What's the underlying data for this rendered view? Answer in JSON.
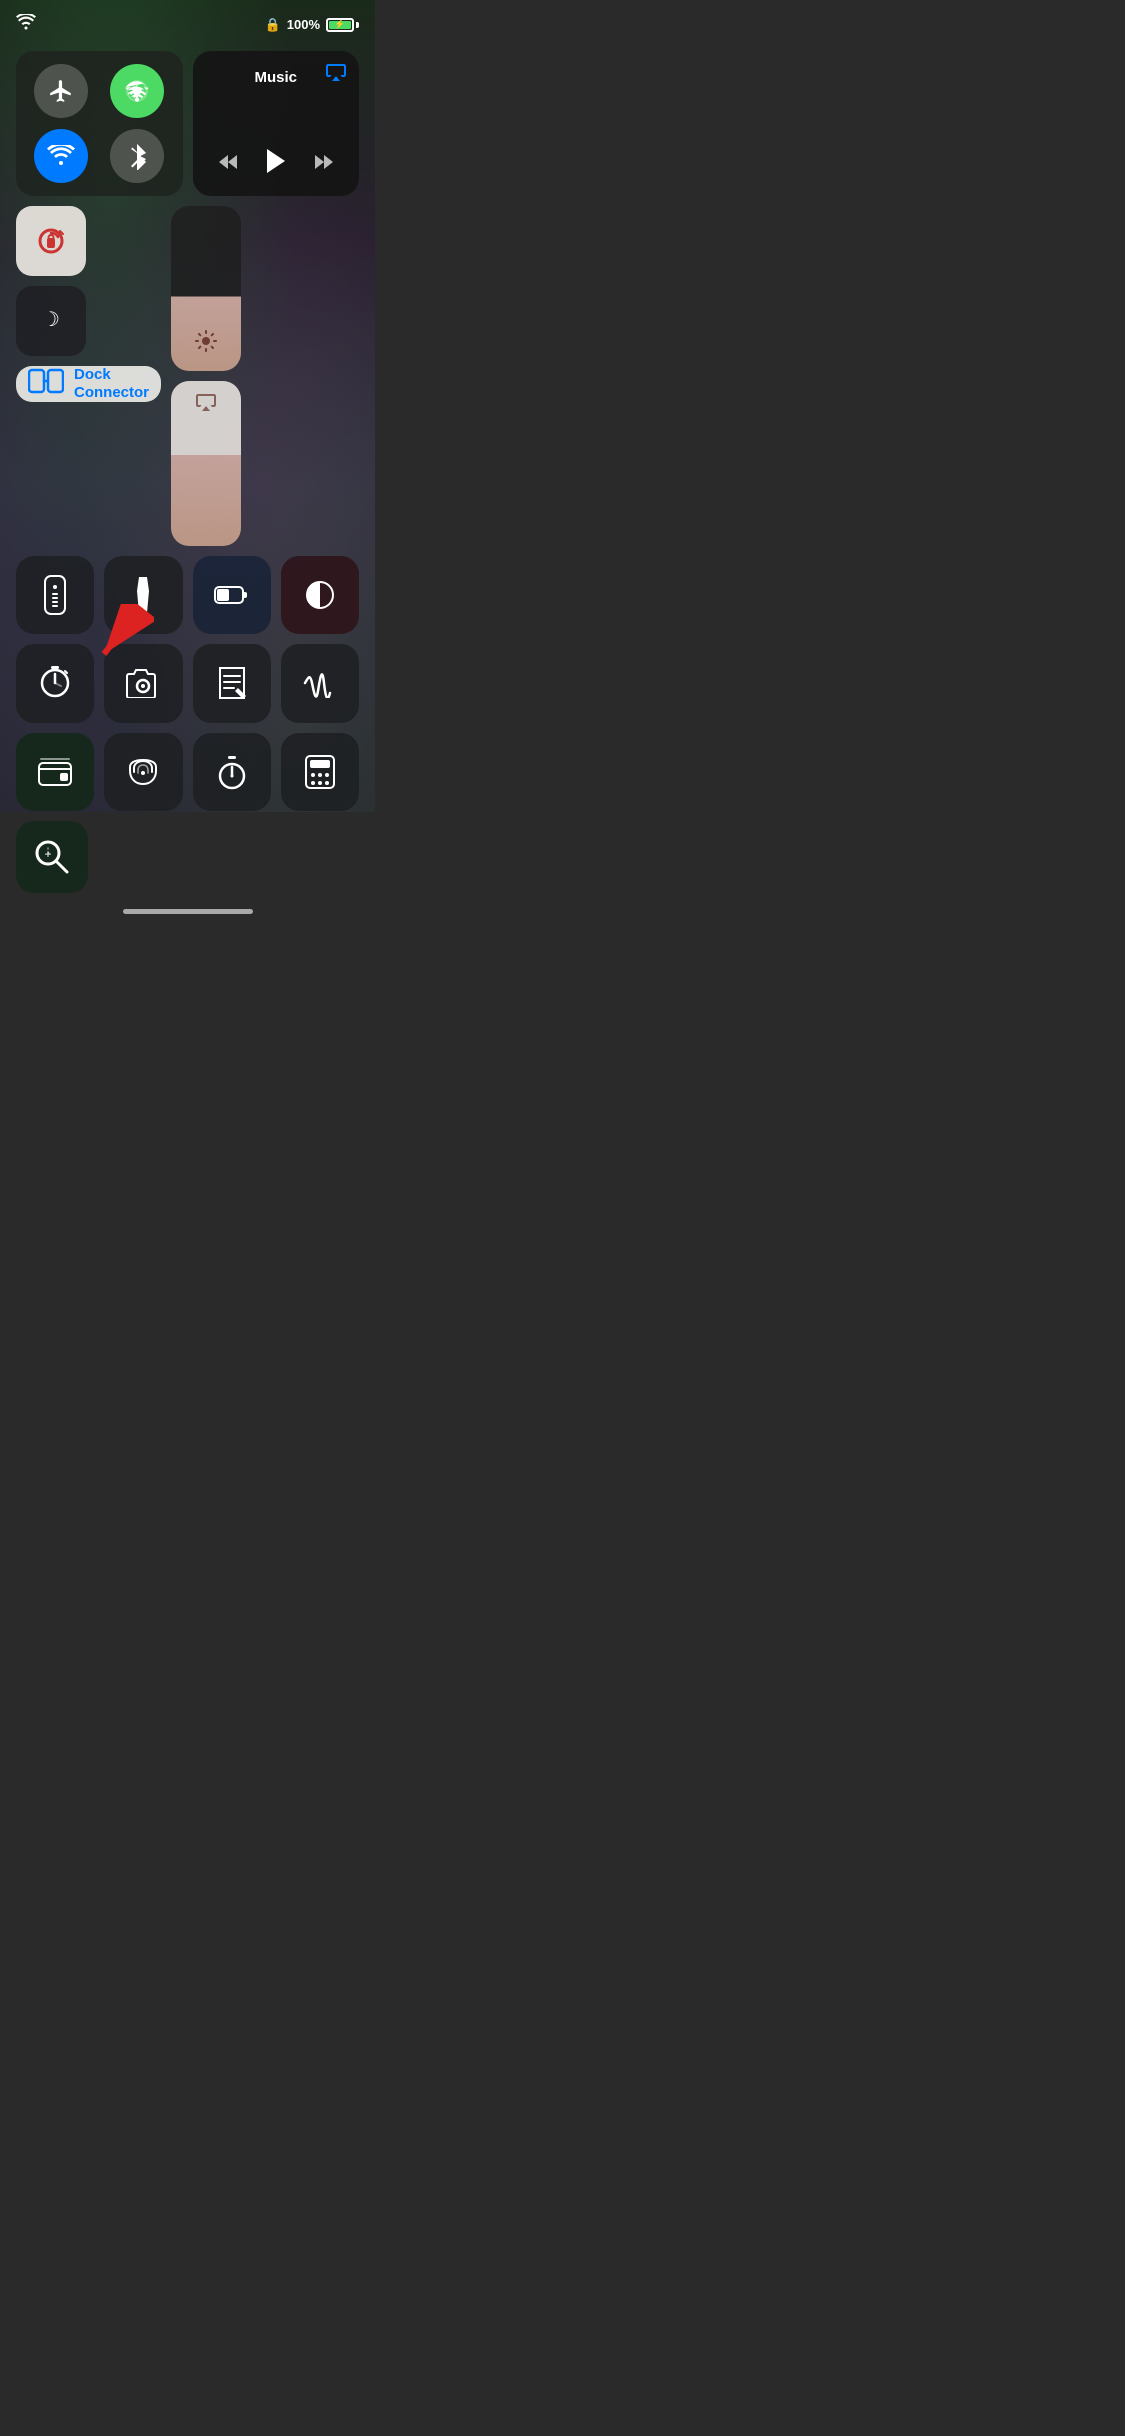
{
  "status_bar": {
    "battery_percent": "100%",
    "wifi_signal": "wifi"
  },
  "music_panel": {
    "title": "Music",
    "airplay_icon": "airplay",
    "rewind_label": "⏮",
    "play_label": "▶",
    "fastforward_label": "⏭"
  },
  "connectivity": {
    "airplane_label": "✈",
    "cellular_label": "cellular",
    "wifi_label": "wifi",
    "bluetooth_label": "bluetooth"
  },
  "controls": {
    "rotation_lock_label": "rotation-lock",
    "do_not_disturb_label": "do-not-disturb",
    "brightness_label": "brightness",
    "volume_label": "volume"
  },
  "dock_connector": {
    "label_line1": "Dock",
    "label_line2": "Connector"
  },
  "app_buttons": [
    {
      "id": "remote",
      "icon": "remote",
      "label": "Remote"
    },
    {
      "id": "flashlight",
      "icon": "flashlight",
      "label": "Flashlight"
    },
    {
      "id": "low-power",
      "icon": "battery",
      "label": "Low Power Mode"
    },
    {
      "id": "dark-mode",
      "icon": "dark-mode",
      "label": "Dark Mode"
    },
    {
      "id": "timer",
      "icon": "timer",
      "label": "Timer"
    },
    {
      "id": "camera",
      "icon": "camera",
      "label": "Camera"
    },
    {
      "id": "notes",
      "icon": "notes",
      "label": "Notes"
    },
    {
      "id": "voice-memo",
      "icon": "voice-memo",
      "label": "Voice Memo"
    },
    {
      "id": "wallet",
      "icon": "wallet",
      "label": "Wallet"
    },
    {
      "id": "sound-rec",
      "icon": "sound-rec",
      "label": "Sound Recognition"
    },
    {
      "id": "stopwatch",
      "icon": "stopwatch",
      "label": "Stopwatch"
    },
    {
      "id": "calculator",
      "icon": "calculator",
      "label": "Calculator"
    }
  ],
  "bottom_app": {
    "id": "magnifier",
    "icon": "magnifier",
    "label": "Magnifier"
  }
}
